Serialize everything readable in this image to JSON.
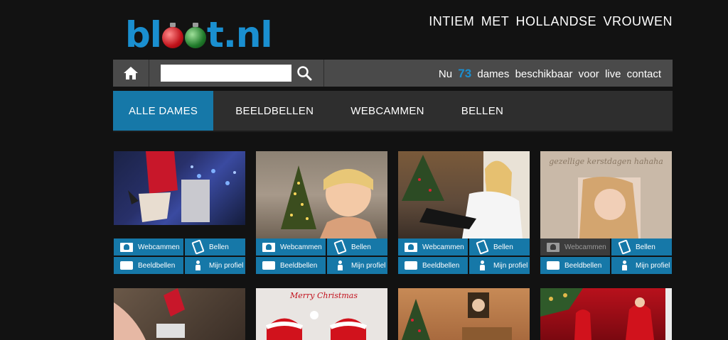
{
  "header": {
    "logo_text_a": "bl",
    "logo_text_b": "t.nl",
    "tagline": "INTIEM MET HOLLANDSE VROUWEN"
  },
  "searchbar": {
    "search_placeholder": "",
    "status_prefix": "Nu",
    "online_count": "73",
    "status_suffix": "dames beschikbaar voor live contact"
  },
  "nav": {
    "tabs": [
      {
        "label": "ALLE DAMES",
        "active": true
      },
      {
        "label": "BEELDBELLEN",
        "active": false
      },
      {
        "label": "WEBCAMMEN",
        "active": false
      },
      {
        "label": "BELLEN",
        "active": false
      }
    ]
  },
  "cards": [
    {
      "webcam_label": "Webcammen",
      "bellen_label": "Bellen",
      "beeld_label": "Beeldbellen",
      "profiel_label": "Mijn profiel",
      "webcam_available": true
    },
    {
      "webcam_label": "Webcammen",
      "bellen_label": "Bellen",
      "beeld_label": "Beeldbellen",
      "profiel_label": "Mijn profiel",
      "webcam_available": true
    },
    {
      "webcam_label": "Webcammen",
      "bellen_label": "Bellen",
      "beeld_label": "Beeldbellen",
      "profiel_label": "Mijn profiel",
      "webcam_available": true
    },
    {
      "webcam_label": "Webcammen",
      "bellen_label": "Bellen",
      "beeld_label": "Beeldbellen",
      "profiel_label": "Mijn profiel",
      "webcam_available": false
    }
  ],
  "card4_photo_caption": "gezellige kerstdagen hahaha",
  "card_row2_banner": "Merry Christmas",
  "colors": {
    "accent": "#1678a8",
    "logo_blue": "#1a8fd0",
    "background": "#121212",
    "bar": "#4a4a4a"
  }
}
